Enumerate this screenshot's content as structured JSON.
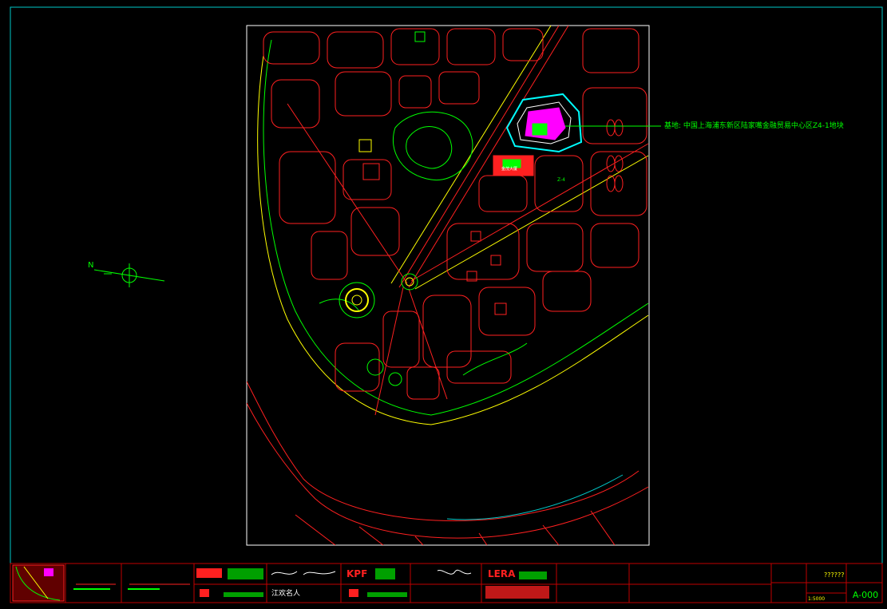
{
  "drawing": {
    "annotation": "基地:  中国上海浦东新区陆家嘴金融贸易中心区Z4-1地块",
    "north_label": "N",
    "plot_label": "Z-4",
    "plot_sublabel": "金茂大厦"
  },
  "title_block": {
    "sheet_number": "A-000",
    "scale": "1:5000",
    "unknown_text": "??????",
    "firm_logos": [
      "KPF",
      "LERA"
    ],
    "signature_text": "江欢名人"
  },
  "colors": {
    "frame": "#00d0d0",
    "road": "#ff2020",
    "building": "#ff2020",
    "park": "#00ff00",
    "river_edge": "#ff2020",
    "highlight": "#ff00ff",
    "roundabout": "#ffff00",
    "text": "#00ff00"
  }
}
